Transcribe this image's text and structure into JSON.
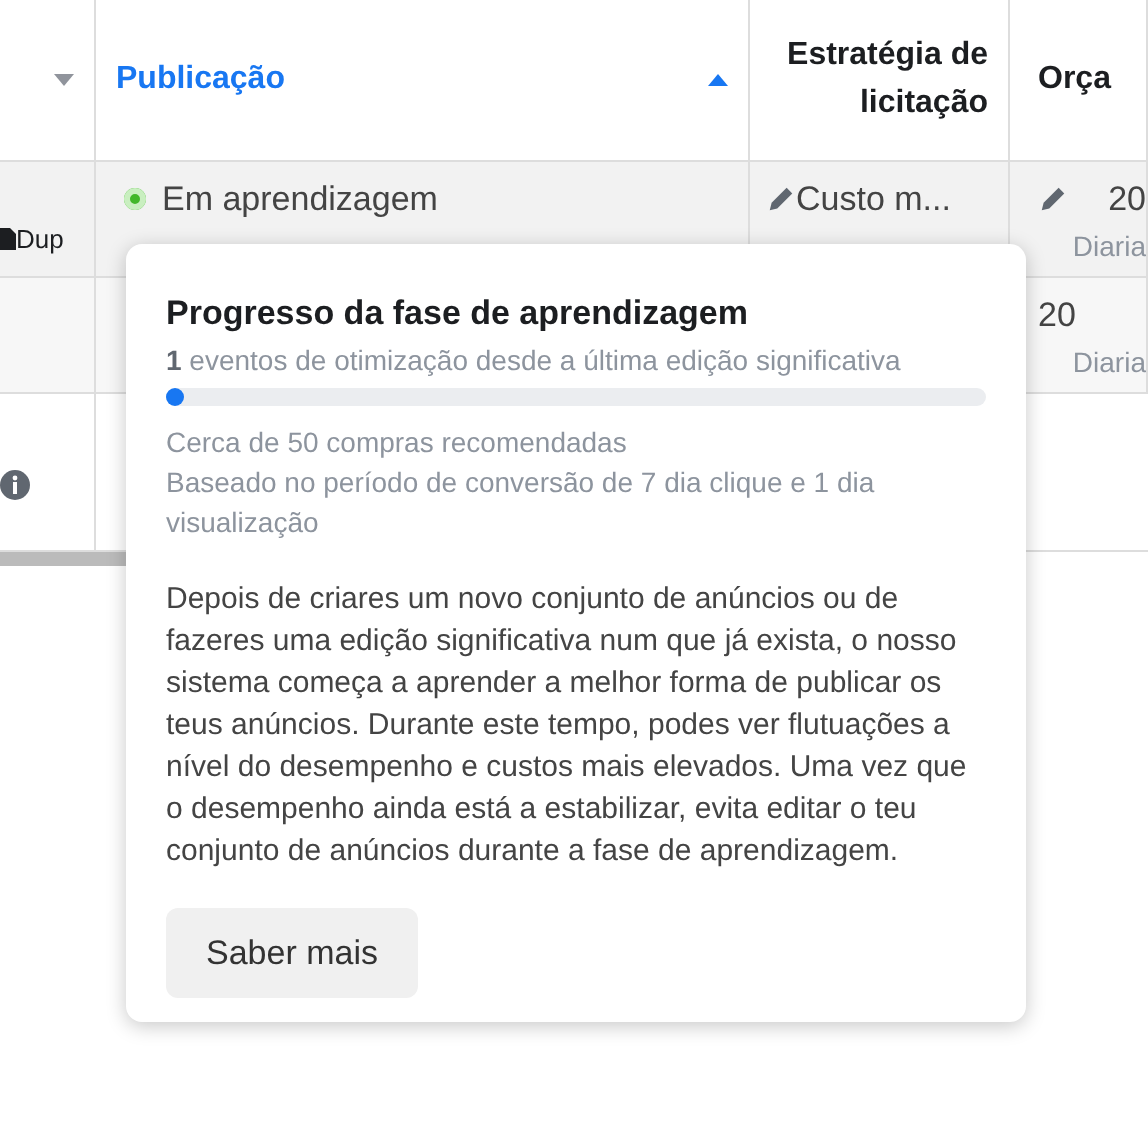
{
  "table": {
    "columns": [
      {
        "kind": "menu"
      },
      {
        "label": "Publicação",
        "sorted": true
      },
      {
        "label": "Estratégia de licitação",
        "sorted": false
      },
      {
        "label": "Orça",
        "sorted": false
      }
    ],
    "rows": [
      {
        "cells": [
          {
            "kind": "file",
            "text": "Dup"
          },
          {
            "status": "Em aprendizagem",
            "color": "#42b72a"
          },
          {
            "edit": true,
            "text": "Custo m..."
          },
          {
            "edit": true,
            "text": "20",
            "sub": "Diaria"
          }
        ]
      },
      {
        "cells": [
          {},
          {},
          {},
          {
            "edit": false,
            "text": "20",
            "sub": "Diaria"
          }
        ]
      },
      {
        "cells": [
          {
            "kind": "info"
          },
          {},
          {},
          {}
        ]
      }
    ]
  },
  "popover": {
    "title": "Progresso da fase de aprendizagem",
    "events": "**1** eventos de otimização desde a última edição significativa",
    "progress": {
      "level": 0.02
    },
    "notes": [
      "Cerca de 50 compras recomendadas",
      "Baseado no período de conversão de 7 dia clique e 1 dia visualização"
    ],
    "body": "Depois de criares um novo conjunto de anúncios ou de fazeres uma edição significativa num que já exista, o nosso sistema começa a aprender a melhor forma de publicar os teus anúncios. Durante este tempo, podes ver flutuações a nível do desempenho e custos mais elevados. Uma vez que o desempenho ainda está a estabilizar, evita editar o teu conjunto de anúncios durante a fase de aprendizagem.",
    "button": "Saber mais"
  }
}
